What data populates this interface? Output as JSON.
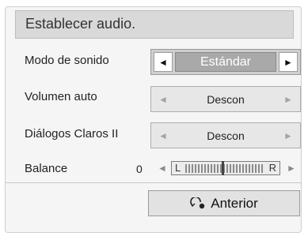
{
  "title": "Establecer audio.",
  "rows": [
    {
      "label": "Modo de sonido",
      "value": "Estándar"
    },
    {
      "label": "Volumen auto",
      "value": "Descon"
    },
    {
      "label": "Diálogos Claros II",
      "value": "Descon"
    }
  ],
  "balance": {
    "label": "Balance",
    "value": "0",
    "left_label": "L",
    "right_label": "R"
  },
  "arrows": {
    "left": "◄",
    "right": "►"
  },
  "footer": {
    "previous_label": "Anterior",
    "previous_icon": "return-icon"
  }
}
